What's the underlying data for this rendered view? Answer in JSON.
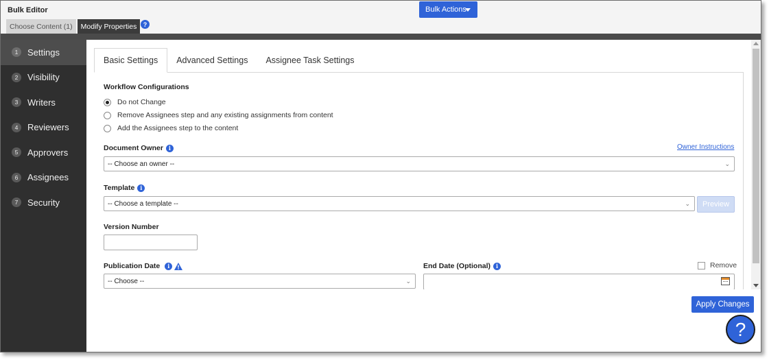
{
  "header": {
    "title": "Bulk Editor",
    "bulk_actions_label": "Bulk Actions",
    "tabs": [
      {
        "label": "Choose Content (1)"
      },
      {
        "label": "Modify Properties"
      }
    ],
    "help_glyph": "?"
  },
  "sidebar": {
    "items": [
      {
        "num": "1",
        "label": "Settings"
      },
      {
        "num": "2",
        "label": "Visibility"
      },
      {
        "num": "3",
        "label": "Writers"
      },
      {
        "num": "4",
        "label": "Reviewers"
      },
      {
        "num": "5",
        "label": "Approvers"
      },
      {
        "num": "6",
        "label": "Assignees"
      },
      {
        "num": "7",
        "label": "Security"
      }
    ]
  },
  "main": {
    "tabs": [
      {
        "label": "Basic Settings"
      },
      {
        "label": "Advanced Settings"
      },
      {
        "label": "Assignee Task Settings"
      }
    ],
    "workflow": {
      "title": "Workflow Configurations",
      "options": [
        {
          "label": "Do not Change",
          "checked": true
        },
        {
          "label": "Remove Assignees step and any existing assignments from content",
          "checked": false
        },
        {
          "label": "Add the Assignees step to the content",
          "checked": false
        }
      ]
    },
    "owner": {
      "label": "Document Owner",
      "link": "Owner Instructions",
      "select_value": "-- Choose an owner --"
    },
    "template": {
      "label": "Template",
      "select_value": "-- Choose a template --",
      "preview_label": "Preview"
    },
    "version": {
      "label": "Version Number",
      "value": ""
    },
    "publication": {
      "label": "Publication Date",
      "select_value": "-- Choose --"
    },
    "end_date": {
      "label": "End Date (Optional)",
      "remove_label": "Remove",
      "value": ""
    },
    "apply_label": "Apply Changes",
    "help_glyph": "?",
    "info_glyph": "i"
  },
  "colors": {
    "accent": "#2f63d8",
    "sidebar_bg": "#2f2f2f",
    "warning": "#2f63d8"
  }
}
